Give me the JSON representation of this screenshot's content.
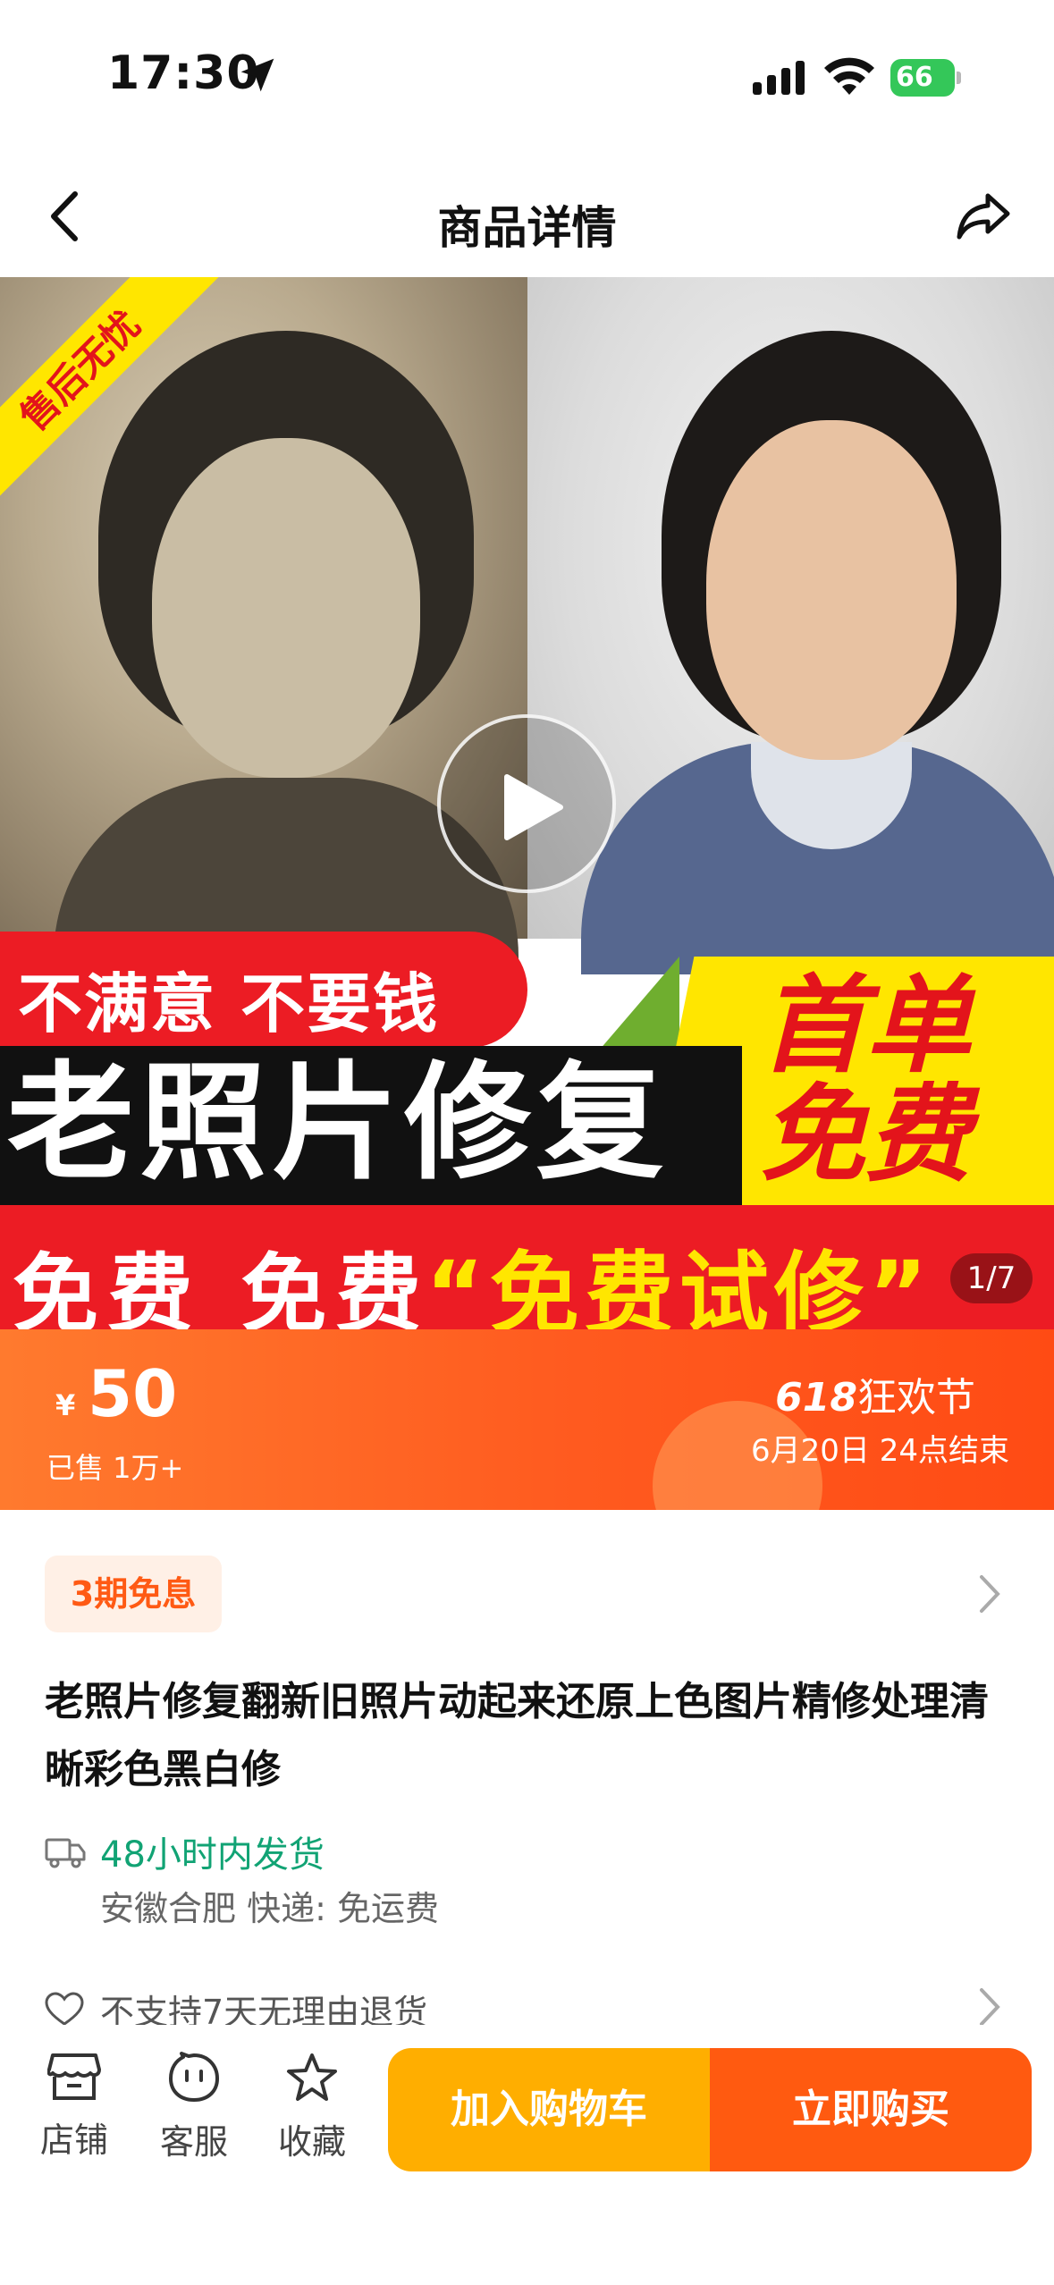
{
  "status_bar": {
    "time": "17:30",
    "battery": "66",
    "icons": [
      "location-arrow-icon",
      "signal-icon",
      "wifi-icon",
      "battery-icon"
    ]
  },
  "nav": {
    "title": "商品详情",
    "back_icon": "chevron-left-icon",
    "share_icon": "share-icon"
  },
  "hero": {
    "ribbon": "售后无忧",
    "slogan": "不满意 不要钱",
    "headline": "老照片修复",
    "badge_line1": "首单",
    "badge_line2": "免费",
    "free_text": "免费 免费",
    "trial_text": "“免费试修”",
    "page_indicator": "1/7",
    "play_icon": "play-icon"
  },
  "price": {
    "currency": "¥",
    "value": "50",
    "sold": "已售 1万+",
    "promo_number": "618",
    "promo_name": "狂欢节",
    "promo_end": "6月20日 24点结束"
  },
  "details": {
    "installment": "3期免息",
    "title": "老照片修复翻新旧照片动起来还原上色图片精修处理清晰彩色黑白修",
    "ship_time": "48小时内发货",
    "ship_from": "安徽合肥  快递: 免运费",
    "return_policy": "不支持7天无理由退货"
  },
  "bottom_bar": {
    "store": "店铺",
    "service": "客服",
    "favorite": "收藏",
    "add_to_cart": "加入购物车",
    "buy_now": "立即购买"
  },
  "colors": {
    "accent_orange": "#ff5a10",
    "cart_yellow": "#ffae00",
    "ship_green": "#11a374",
    "banner_red": "#ec1c24",
    "banner_yellow": "#ffe600"
  }
}
